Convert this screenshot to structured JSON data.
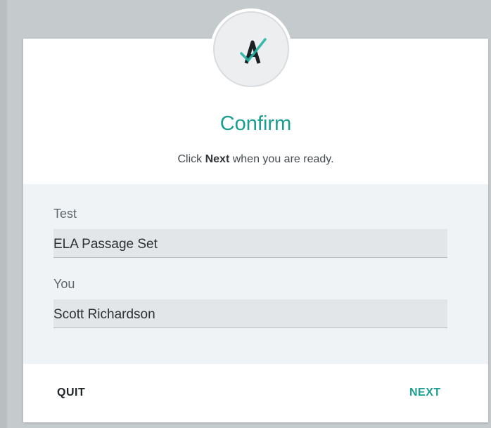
{
  "dialog": {
    "logo_icon": "a-check-logo-icon",
    "title": "Confirm",
    "subtitle_prefix": "Click ",
    "subtitle_bold": "Next",
    "subtitle_suffix": " when you are ready.",
    "accent_color": "#1a9e8f"
  },
  "fields": {
    "test_label": "Test",
    "test_value": "ELA Passage Set",
    "you_label": "You",
    "you_value": "Scott Richardson"
  },
  "footer": {
    "quit_label": "QUIT",
    "next_label": "NEXT"
  }
}
